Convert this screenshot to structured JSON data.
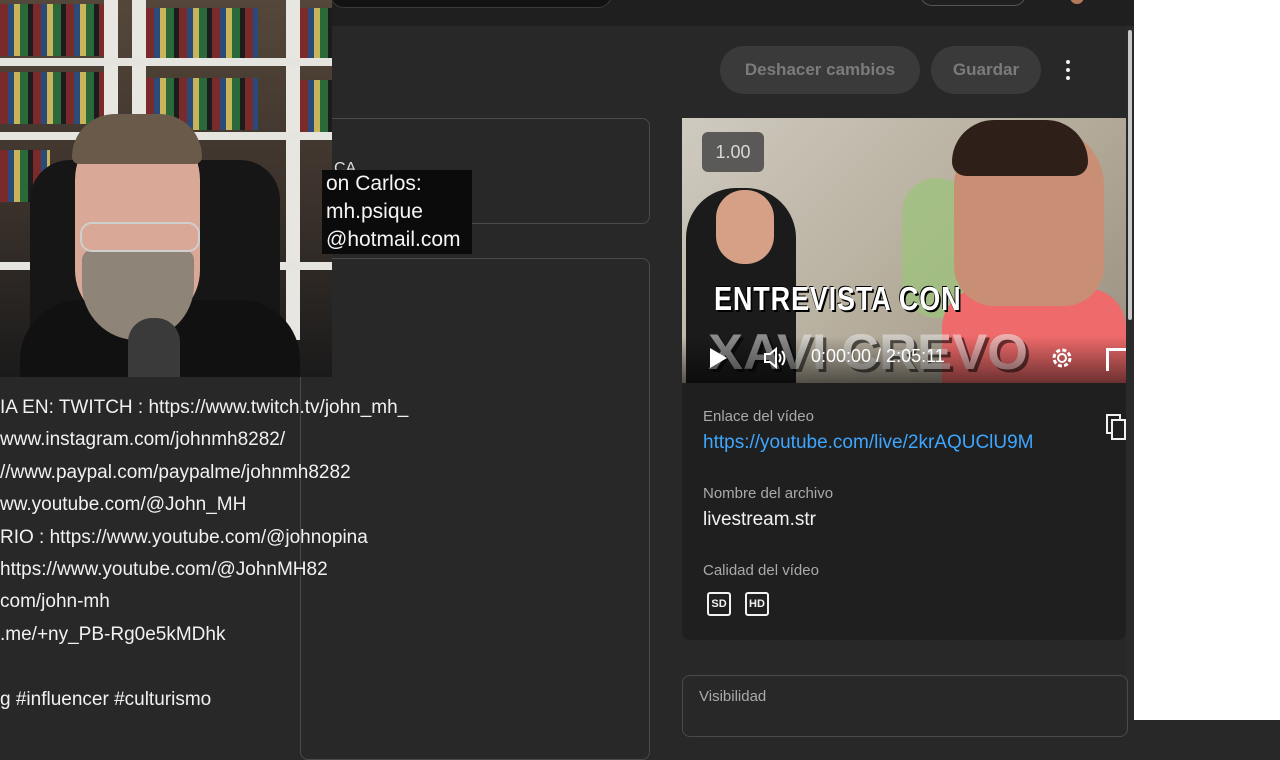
{
  "toolbar": {
    "undo_label": "Deshacer cambios",
    "save_label": "Guardar",
    "more_icon": "kebab-menu-icon"
  },
  "details_panel": {
    "partial_label": "CA"
  },
  "overlay": {
    "lines": [
      "on Carlos:",
      "mh.psique",
      "@hotmail.com"
    ]
  },
  "description": {
    "lines": [
      "IA EN: TWITCH : https://www.twitch.tv/john_mh_",
      "www.instagram.com/johnmh8282/",
      "//www.paypal.com/paypalme/johnmh8282",
      "ww.youtube.com/@John_MH",
      "RIO : https://www.youtube.com/@johnopina",
      "https://www.youtube.com/@JohnMH82",
      "com/john-mh",
      ".me/+ny_PB-Rg0e5kMDhk",
      "",
      "g #influencer #culturismo"
    ]
  },
  "video": {
    "speed": "1.00",
    "thumbnail_title_1": "ENTREVISTA CON",
    "thumbnail_title_2": "XAVI CREVO",
    "time": "0:00:00 / 2:05:11",
    "link_label": "Enlace del vídeo",
    "link": "https://youtube.com/live/2krAQUClU9M",
    "filename_label": "Nombre del archivo",
    "filename": "livestream.str",
    "quality_label": "Calidad del vídeo",
    "quality_badges": [
      "SD",
      "HD"
    ],
    "icons": [
      "play-icon",
      "volume-icon",
      "settings-icon",
      "fullscreen-icon",
      "copy-icon"
    ]
  },
  "visibility": {
    "label": "Visibilidad"
  },
  "colors": {
    "background": "#282828",
    "link": "#3ea6ff",
    "button_bg": "#3a3a3a"
  }
}
